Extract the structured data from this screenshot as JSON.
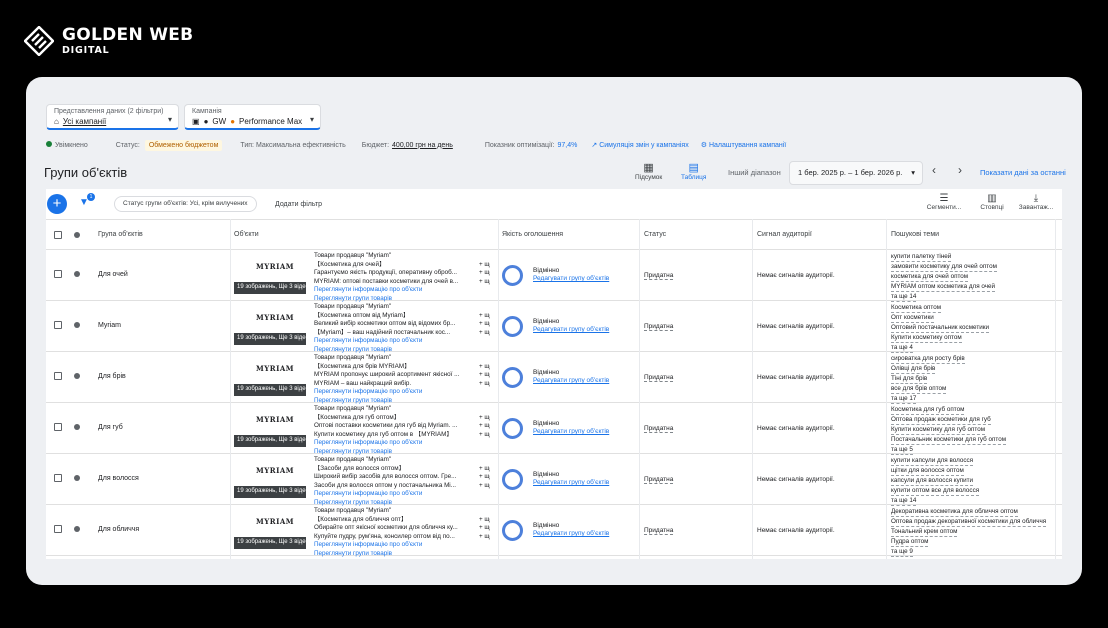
{
  "brand": {
    "line1": "GOLDEN WEB",
    "line2": "DIGITAL"
  },
  "selectors": {
    "view": {
      "label": "Представлення даних (2 фільтри)",
      "value": "Усі кампанії"
    },
    "campaign": {
      "label": "Кампанія",
      "value": "GW",
      "value2": "Performance Max"
    }
  },
  "statusbar": {
    "enabled": "Увімкнено",
    "status_label": "Статус:",
    "status_value": "Обмежено бюджетом",
    "type": "Тип: Максимальна ефективність",
    "budget_label": "Бюджет:",
    "budget_value": "400,00 грн на день",
    "opt": "Показник оптимізації:",
    "opt_value": "97,4%",
    "simulate": "Симуляція змін у кампаніях",
    "settings": "Налаштування кампанії"
  },
  "page": {
    "title": "Групи об'єктів",
    "summary": "Підсумок",
    "table": "Таблиця",
    "range_label": "Інший діапазон",
    "range": "1 бер. 2025 р. – 1 бер. 2026 р.",
    "show_data": "Показати дані за останні"
  },
  "toolbar": {
    "add": "+",
    "filter_count": "1",
    "chip": "Статус групи об'єктів: Усі, крім вилучених",
    "add_filter": "Додати фільтр",
    "segments": "Сегменти...",
    "columns": "Стовпці",
    "download": "Завантаж..."
  },
  "columns": [
    "Група об'єктів",
    "Об'єкти",
    "Якість оголошення",
    "Статус",
    "Сигнал аудиторії",
    "Пошукові теми"
  ],
  "rows": [
    {
      "name": "Для очей",
      "thumb": "19 зображень, Ще 3 відео",
      "assets": [
        "Товари продавця \"Myriam\"",
        "【Косметика для очей】",
        "Гарантуємо якість продукції, оперативну оброб...",
        "MYRIAM: оптові поставки косметики для очей в..."
      ],
      "more": [
        "+ ще 13",
        "+ ще 2",
        "+ ще 4"
      ],
      "quality": "Відмінно",
      "quality_link": "Редагувати групу об'єктів",
      "status": "Придатна",
      "signal": "Немає сигналів аудиторії.",
      "topics": [
        "купити палетку тіней",
        "замовити косметику для очей оптом",
        "косметика для очей оптом",
        "MYRIAM оптом косметика для очей",
        "та ще 14"
      ]
    },
    {
      "name": "Myriam",
      "thumb": "19 зображень, Ще 3 відео",
      "assets": [
        "Товари продавця \"Myriam\"",
        "【Косметика оптом від Myriam】",
        "Великий вибір косметики оптом від відомих бр...",
        "【Myriam】– ваш надійний постачальник кос..."
      ],
      "more": [
        "+ ще 10",
        "+ ще 3",
        "+ ще 3"
      ],
      "quality": "Відмінно",
      "quality_link": "Редагувати групу об'єктів",
      "status": "Придатна",
      "signal": "Немає сигналів аудиторії.",
      "topics": [
        "Косметика оптом",
        "Опт косметики",
        "Оптовий постачальник косметики",
        "Купити косметику оптом",
        "та ще 4"
      ]
    },
    {
      "name": "Для брів",
      "thumb": "19 зображень, Ще 3 відео",
      "assets": [
        "Товари продавця \"Myriam\"",
        "【Косметика для брів MYRIAM】",
        "MYRIAM пропонує широкий асортимент якісної ...",
        "MYRIAM – ваш найкращий вибір."
      ],
      "more": [
        "+ ще 13",
        "+ ще 3",
        "+ ще 3"
      ],
      "quality": "Відмінно",
      "quality_link": "Редагувати групу об'єктів",
      "status": "Придатна",
      "signal": "Немає сигналів аудиторії.",
      "topics": [
        "сироватка для росту брів",
        "Олівці для брів",
        "Тіні для брів",
        "все для брів оптом",
        "та ще 17"
      ]
    },
    {
      "name": "Для губ",
      "thumb": "19 зображень, Ще 3 відео",
      "assets": [
        "Товари продавця \"Myriam\"",
        "【Косметика для губ оптом】",
        "Оптові поставки косметики для губ від Myriam. ...",
        "Купити косметику для губ оптом в 【MYRIAM】"
      ],
      "more": [
        "+ ще 10",
        "+ ще 3",
        "+ ще 3"
      ],
      "quality": "Відмінно",
      "quality_link": "Редагувати групу об'єктів",
      "status": "Придатна",
      "signal": "Немає сигналів аудиторії.",
      "topics": [
        "Косметика для губ оптом",
        "Оптова продаж косметики для губ",
        "Купити косметику для губ оптом",
        "Постачальник косметики для губ оптом",
        "та ще 5"
      ]
    },
    {
      "name": "Для волосся",
      "thumb": "19 зображень, Ще 3 відео",
      "assets": [
        "Товари продавця \"Myriam\"",
        "【Засоби для волосся оптом】",
        "Широкий вибір засобів для волосся оптом. Гре...",
        "Засоби для волосся оптом у постачальника Mi..."
      ],
      "more": [
        "+ ще 14",
        "+ ще 4",
        "+ ще 4"
      ],
      "quality": "Відмінно",
      "quality_link": "Редагувати групу об'єктів",
      "status": "Придатна",
      "signal": "Немає сигналів аудиторії.",
      "topics": [
        "купити капсули для волосся",
        "щітки для волосся оптом",
        "капсули для волосся купити",
        "купити оптом все для волосся",
        "та ще 14"
      ]
    },
    {
      "name": "Для обличчя",
      "thumb": "19 зображень, Ще 3 відео",
      "assets": [
        "Товари продавця \"Myriam\"",
        "【Косметика для обличчя опт】",
        "Обирайте опт якісної косметики для обличчя ку...",
        "Купуйте пудру, рум'яна, консилер оптом від по..."
      ],
      "more": [
        "+ ще 11",
        "+ ще 4",
        "+ ще 5"
      ],
      "quality": "Відмінно",
      "quality_link": "Редагувати групу об'єктів",
      "status": "Придатна",
      "signal": "Немає сигналів аудиторії.",
      "topics": [
        "Декоративна косметика для обличчя оптом",
        "Оптова продаж декоративної косметики для обличчя",
        "Тональний крем оптом",
        "Пудра оптом",
        "та ще 9"
      ]
    }
  ],
  "asset_links": [
    "Переглянути інформацію про об'єкти",
    "Переглянути групи товарів"
  ],
  "thumb_logo": "MYRIAM"
}
